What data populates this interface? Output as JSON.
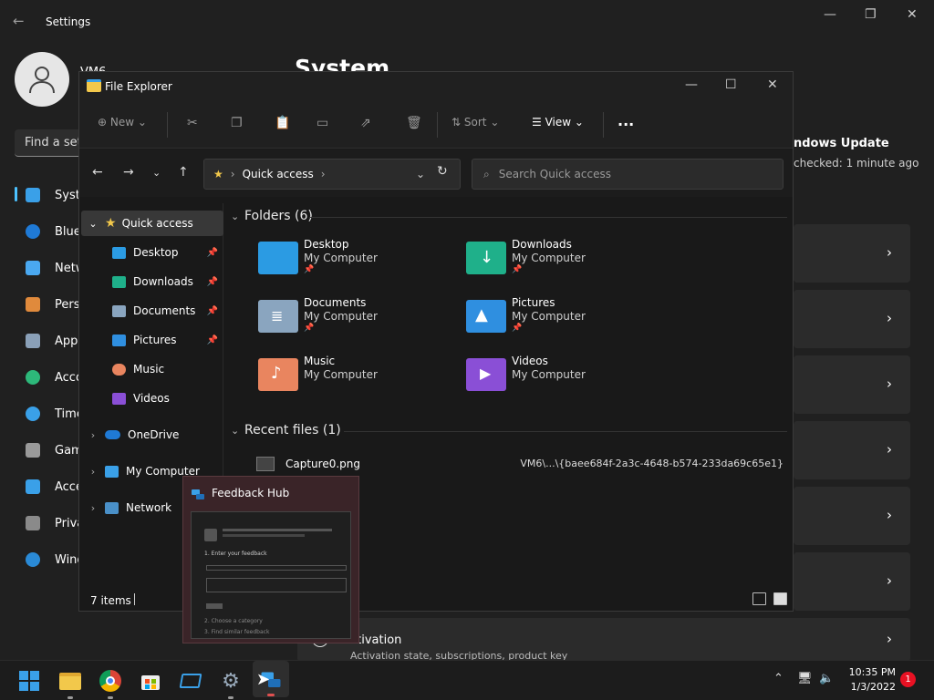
{
  "settings": {
    "title": "Settings",
    "user_name": "VM6",
    "page_title": "System",
    "search_placeholder": "Find a set",
    "nav": [
      "Syste",
      "Blue",
      "Netw",
      "Pers",
      "App",
      "Acco",
      "Time",
      "Gam",
      "Acce",
      "Priva",
      "Wind"
    ],
    "update_title": "ndows Update",
    "update_sub": "checked: 1 minute ago",
    "activation_title": "ctivation",
    "activation_sub": "Activation state, subscriptions, product key"
  },
  "explorer": {
    "title": "File Explorer",
    "toolbar": {
      "new": "New",
      "sort": "Sort",
      "view": "View",
      "more": "..."
    },
    "address": {
      "location": "Quick access"
    },
    "search_placeholder": "Search Quick access",
    "tree": [
      {
        "label": "Quick access",
        "icon": "star-icon"
      },
      {
        "label": "Desktop",
        "icon": "desktop-icon"
      },
      {
        "label": "Downloads",
        "icon": "download-icon"
      },
      {
        "label": "Documents",
        "icon": "document-icon"
      },
      {
        "label": "Pictures",
        "icon": "pictures-icon"
      },
      {
        "label": "Music",
        "icon": "music-icon"
      },
      {
        "label": "Videos",
        "icon": "videos-icon"
      },
      {
        "label": "OneDrive",
        "icon": "cloud-icon"
      },
      {
        "label": "My Computer",
        "icon": "computer-icon"
      },
      {
        "label": "Network",
        "icon": "network-icon"
      }
    ],
    "folders_header": "Folders (6)",
    "folders": [
      {
        "name": "Desktop",
        "location": "My Computer",
        "color": "#2b9be3"
      },
      {
        "name": "Downloads",
        "location": "My Computer",
        "color": "#1fb08a"
      },
      {
        "name": "Documents",
        "location": "My Computer",
        "color": "#8aa5bf"
      },
      {
        "name": "Pictures",
        "location": "My Computer",
        "color": "#2f8fe0"
      },
      {
        "name": "Music",
        "location": "My Computer",
        "color": "#e9855f"
      },
      {
        "name": "Videos",
        "location": "My Computer",
        "color": "#8a4fd6"
      }
    ],
    "recent_header": "Recent files (1)",
    "recent": [
      {
        "name": "Capture0.png",
        "path": "VM6\\...\\{baee684f-2a3c-4648-b574-233da69c65e1}"
      }
    ],
    "status": "7 items"
  },
  "popup": {
    "title": "Feedback Hub",
    "thumb_lines": [
      "1. Enter your feedback",
      "2. Choose a category",
      "3. Find similar feedback"
    ]
  },
  "taskbar": {
    "time": "10:35 PM",
    "date": "1/3/2022",
    "notifications": "1"
  }
}
